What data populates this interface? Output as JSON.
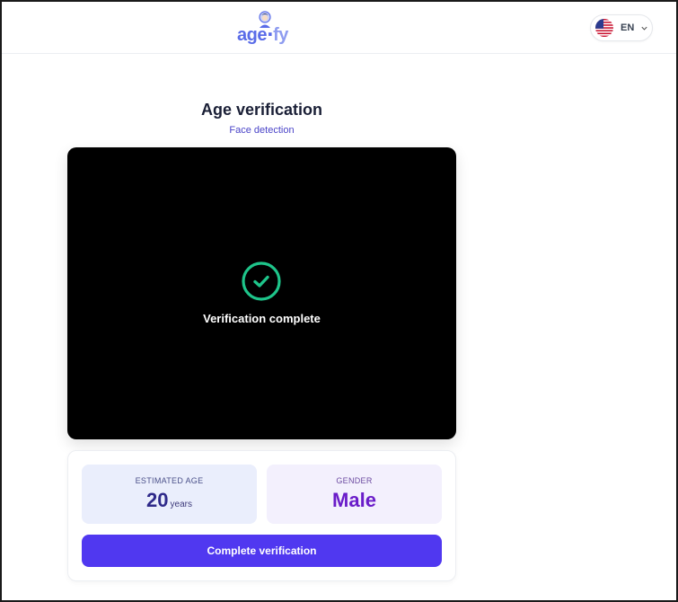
{
  "header": {
    "logo": {
      "text_a": "age",
      "text_b": "fy"
    },
    "language": {
      "code": "EN",
      "flag_icon": "us-flag-icon"
    }
  },
  "main": {
    "title": "Age verification",
    "subtitle": "Face detection",
    "camera": {
      "status_icon": "check-circle-icon",
      "status_color": "#1ec48a",
      "message": "Verification complete"
    },
    "results": {
      "age": {
        "label": "ESTIMATED AGE",
        "value": "20",
        "unit": "years"
      },
      "gender": {
        "label": "GENDER",
        "value": "Male"
      }
    },
    "complete_button": "Complete verification"
  },
  "colors": {
    "accent": "#5038f0",
    "age_bg": "#eaeefc",
    "gender_bg": "#f3f0fd",
    "gender_text": "#6a1cc9",
    "success": "#1ec48a"
  }
}
